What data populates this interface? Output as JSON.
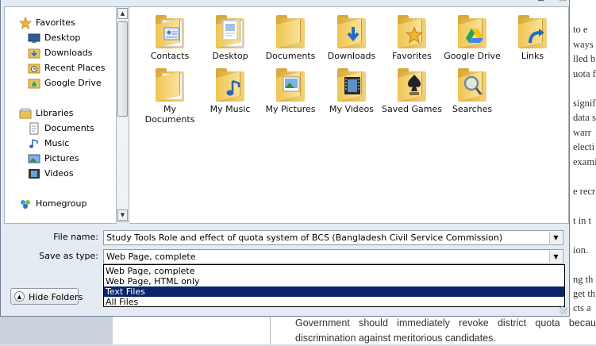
{
  "background": {
    "right_fragments": [
      "to e",
      "ways",
      "lled b",
      "uota f",
      "signif",
      "data s",
      "warr",
      "electi",
      "exami",
      "e recr",
      "t in t",
      "ion.",
      "ng th",
      "get th",
      "cts a"
    ],
    "bottom_lines": [
      "Government should immediately revoke district quota becau",
      "discrimination against meritorious candidates."
    ]
  },
  "nav": {
    "favorites": {
      "label": "Favorites",
      "icon": "star-icon"
    },
    "favorites_items": [
      {
        "label": "Desktop",
        "icon": "desktop-icon"
      },
      {
        "label": "Downloads",
        "icon": "downloads-folder-icon"
      },
      {
        "label": "Recent Places",
        "icon": "recent-places-icon"
      },
      {
        "label": "Google Drive",
        "icon": "google-drive-icon"
      }
    ],
    "libraries": {
      "label": "Libraries",
      "icon": "libraries-icon"
    },
    "libraries_items": [
      {
        "label": "Documents",
        "icon": "documents-icon"
      },
      {
        "label": "Music",
        "icon": "music-icon"
      },
      {
        "label": "Pictures",
        "icon": "pictures-icon"
      },
      {
        "label": "Videos",
        "icon": "videos-icon"
      }
    ],
    "homegroup": {
      "label": "Homegroup",
      "icon": "homegroup-icon"
    }
  },
  "files": [
    {
      "label": "Contacts",
      "icon": "contacts-folder-icon"
    },
    {
      "label": "Desktop",
      "icon": "desktop-folder-icon"
    },
    {
      "label": "Documents",
      "icon": "documents-folder-icon"
    },
    {
      "label": "Downloads",
      "icon": "downloads-folder-icon"
    },
    {
      "label": "Favorites",
      "icon": "favorites-folder-icon"
    },
    {
      "label": "Google Drive",
      "icon": "google-drive-folder-icon"
    },
    {
      "label": "Links",
      "icon": "links-folder-icon"
    },
    {
      "label": "My Documents",
      "icon": "my-documents-folder-icon"
    },
    {
      "label": "My Music",
      "icon": "my-music-folder-icon"
    },
    {
      "label": "My Pictures",
      "icon": "my-pictures-folder-icon"
    },
    {
      "label": "My Videos",
      "icon": "my-videos-folder-icon"
    },
    {
      "label": "Saved Games",
      "icon": "saved-games-folder-icon"
    },
    {
      "label": "Searches",
      "icon": "searches-folder-icon"
    }
  ],
  "form": {
    "filename_label": "File name:",
    "filename_value": "Study Tools  Role and effect of quota system of BCS (Bangladesh Civil Service Commission)",
    "savetype_label": "Save as type:",
    "savetype_value": "Web Page, complete",
    "savetype_options": [
      "Web Page, complete",
      "Web Page, HTML only",
      "Text Files",
      "All Files"
    ],
    "selected_option": "Text Files"
  },
  "hide_folders_label": "Hide Folders",
  "colors": {
    "selection": "#0a246a",
    "folder": "#efc552",
    "dialog_bg": "#e4ebf2"
  }
}
